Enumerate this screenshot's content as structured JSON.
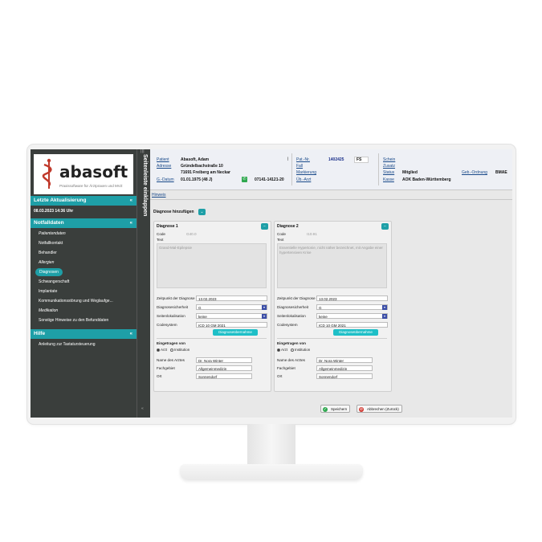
{
  "sidebar": {
    "logo_name": "abasoft",
    "logo_tagline": "Praxissoftware für Ärztpraxen und MVZ",
    "vertical_label": "Seitenleiste einklappen",
    "sections": {
      "updates": {
        "title": "Letzte Aktualisierung",
        "timestamp": "08.03.2023 14:36 Uhr"
      },
      "emergency": {
        "title": "Notfalldaten",
        "items": [
          {
            "label": "Patientendaten"
          },
          {
            "label": "Notfallkontakt"
          },
          {
            "label": "Behandler"
          },
          {
            "label": "Allergien"
          },
          {
            "label": "Diagnosen"
          },
          {
            "label": "Schwangerschaft"
          },
          {
            "label": "Implantate"
          },
          {
            "label": "Kommunikationsstörung und Weglaufge..."
          },
          {
            "label": "Medikation"
          },
          {
            "label": "Sonstige Hinweise zu den Befunddaten"
          }
        ]
      },
      "help": {
        "title": "Hilfe",
        "items": [
          {
            "label": "Anleitung zur Tastatursteuerung"
          }
        ]
      }
    },
    "collapse_glyph": "«",
    "section_chevron": "«"
  },
  "header": {
    "patient_label": "Patient",
    "patient_value": "Abasoft, Adam",
    "address_label": "Adresse",
    "address_line1": "Gründelbachstraße 10",
    "address_line2": "71691 Freiberg am Neckar",
    "dob_label": "G.-Datum",
    "dob_value": "01.01.1975 (48 J)",
    "phone_value": "07141-14121-20",
    "patnr_label": "Pat.-Nr.",
    "patnr_value": "1402425",
    "patnr_suffix": "FS",
    "case_label": "Fall",
    "marking_label": "Markierung",
    "ueb_label": "Üb.-Arzt",
    "schein_label": "Schein",
    "zusatz_label": "Zusatz",
    "status_label": "Status",
    "status_value": "Mitglied",
    "gebo_label": "Geb.-Ordnung",
    "gebo_value": "BMAE",
    "kasse_label": "Kasse",
    "kasse_value": "AOK Baden-Württemberg"
  },
  "hint_link": "Hinweis",
  "add_diagnosis_label": "Diagnose hinzufügen",
  "panel_labels": {
    "code": "Code",
    "text": "Text",
    "date": "Zeitpunkt der Diagnose",
    "certainty": "Diagnosesicherheit",
    "side": "Seitenlokalisation",
    "codesystem": "Codesystem",
    "apply_button": "Diagnoseübernahme",
    "entered_by": "Eingetragen von",
    "radio_doctor": "Arzt",
    "radio_institution": "Institution",
    "doctor_name": "Name des Arztes",
    "specialty": "Fachgebiet",
    "place": "Ort"
  },
  "diagnoses": [
    {
      "title": "Diagnose 1",
      "code": "G40.0",
      "text": "Grand-Mal-Epilepsie",
      "date": "13.02.2023",
      "certainty": "G",
      "side": "keine",
      "codesystem": "ICD 10 GM 2021",
      "doctor": "Dr. Nora Winter",
      "specialty": "Allgemeinmedizin",
      "place": "Sonnendorf"
    },
    {
      "title": "Diagnose 2",
      "code": "I10.91",
      "text": "Essentielle Hypertonie, nicht näher bezeichnet, mit Angabe einer hypertensiven Krise",
      "date": "13.02.2023",
      "certainty": "G",
      "side": "keine",
      "codesystem": "ICD 10 GM 2021",
      "doctor": "Dr. Nora Winter",
      "specialty": "Allgemeinmedizin",
      "place": "Sonnendorf"
    }
  ],
  "footer": {
    "save_label": "Speichern",
    "cancel_label": "Abbrechen (Zurück)"
  },
  "colors": {
    "accent": "#1e9fa7",
    "sidebar_bg": "#3a3e3c",
    "content_bg": "#e8e8e8",
    "link": "#1a4a8a"
  }
}
